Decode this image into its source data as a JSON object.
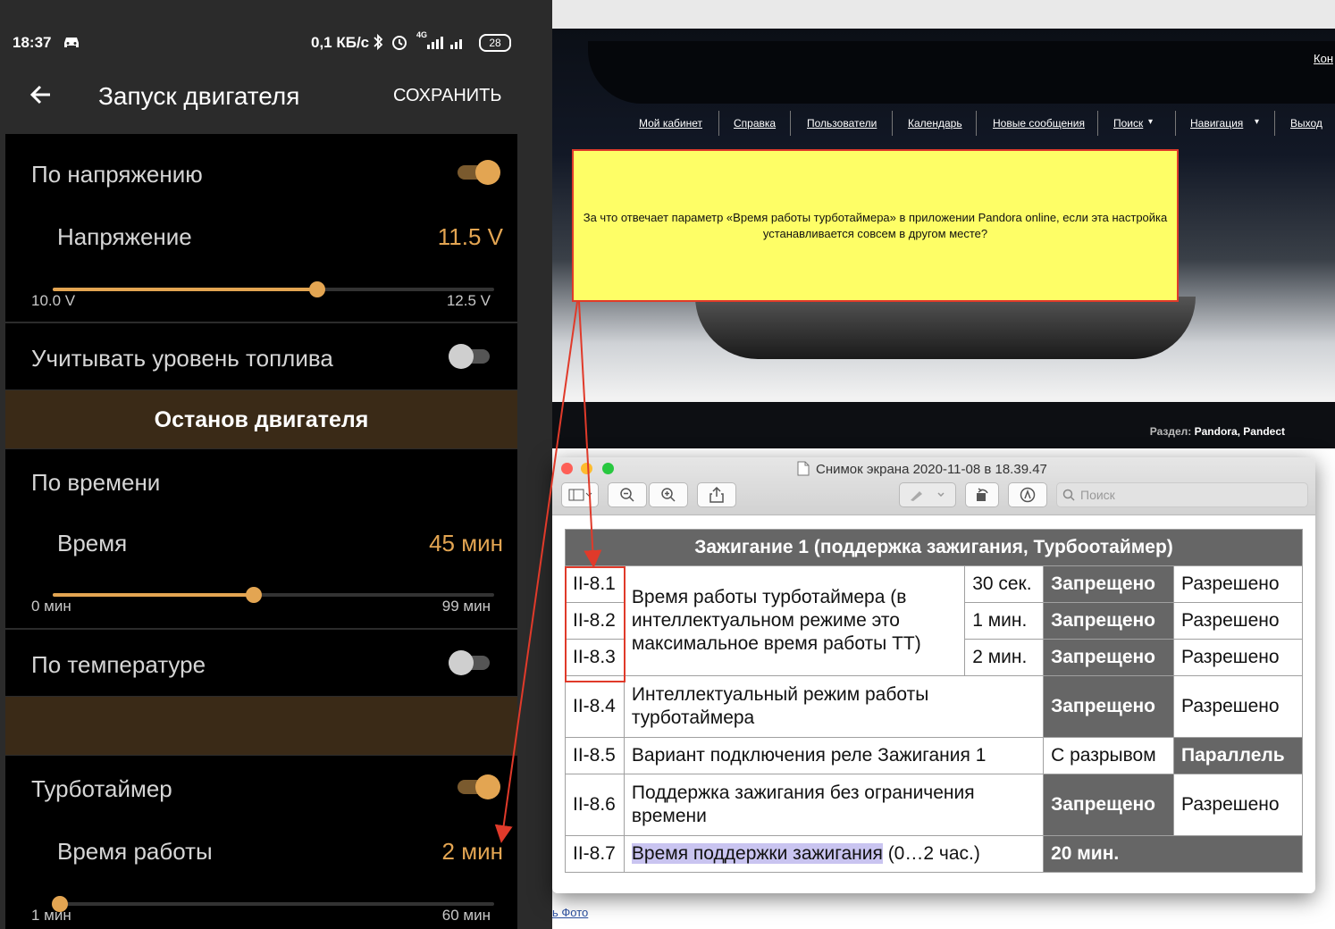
{
  "phone": {
    "status": {
      "time": "18:37",
      "speed": "0,1 КБ/с",
      "battery": "28",
      "network": "4G"
    },
    "appbar": {
      "title": "Запуск двигателя",
      "save": "СОХРАНИТЬ"
    },
    "voltage": {
      "label": "По напряжению",
      "toggle": true,
      "sub_label": "Напряжение",
      "value": "11.5 V",
      "min": "10.0 V",
      "max": "12.5 V",
      "level": 0.6
    },
    "fuel": {
      "label": "Учитывать уровень топлива",
      "toggle": false
    },
    "stop_section": {
      "title": "Останов двигателя"
    },
    "time": {
      "label": "По времени",
      "sub_label": "Время",
      "value": "45 мин",
      "min": "0 мин",
      "max": "99 мин",
      "level": 0.4545
    },
    "temp": {
      "label": "По температуре",
      "toggle": false
    },
    "turbo": {
      "label": "Турботаймер",
      "toggle": true,
      "sub_label": "Время работы",
      "value": "2 мин",
      "min": "1 мин",
      "max": "60 мин",
      "level": 0.0169
    }
  },
  "browser": {
    "nav": [
      "Мой кабинет",
      "Справка",
      "Пользователи",
      "Календарь",
      "Новые сообщения",
      "Поиск",
      "Навигация",
      "Выход"
    ],
    "corner_link": "Кон",
    "section_label": "Раздел:",
    "section_value": "Pandora, Pandect",
    "photo_link": "ь Фото",
    "note": "За что отвечает параметр «Время работы турботаймера» в приложении Pandora online, если эта настройка устанавливается совсем в другом месте?"
  },
  "preview": {
    "title": "Снимок экрана 2020-11-08 в 18.39.47",
    "search_placeholder": "Поиск",
    "table": {
      "header": "Зажигание 1 (поддержка зажигания, Турбоотаймер)",
      "row1": {
        "codes": [
          "II-8.1",
          "II-8.2",
          "II-8.3"
        ],
        "desc": "Время работы турботаймера (в интеллектуальном режиме это максимальное время работы ТТ)",
        "values": [
          "30 сек.",
          "1 мин.",
          "2 мин."
        ],
        "a": "Запрещено",
        "b": "Разрешено"
      },
      "row4": {
        "code": "II-8.4",
        "desc": "Интеллектуальный режим работы турботаймера",
        "a": "Запрещено",
        "b": "Разрешено"
      },
      "row5": {
        "code": "II-8.5",
        "desc": "Вариант подключения реле Зажигания 1",
        "a": "С разрывом",
        "b": "Параллель"
      },
      "row6": {
        "code": "II-8.6",
        "desc": "Поддержка зажигания без ограничения времени",
        "a": "Запрещено",
        "b": "Разрешено"
      },
      "row7": {
        "code": "II-8.7",
        "desc_highlight": "Время поддержки зажигания",
        "desc_rest": " (0…2 час.)",
        "value": "20 мин."
      }
    }
  }
}
